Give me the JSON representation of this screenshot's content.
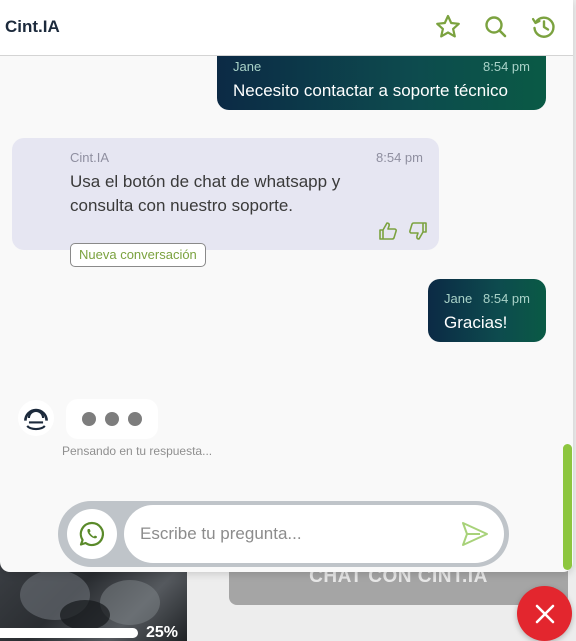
{
  "header": {
    "title": "Cint.IA",
    "icons": [
      "star-icon",
      "search-icon",
      "history-icon"
    ],
    "accent": "#7ba23f"
  },
  "messages": [
    {
      "sender": "Jane",
      "time": "8:54 pm",
      "text": "Necesito contactar a soporte técnico"
    },
    {
      "sender": "Cint.IA",
      "time": "8:54 pm",
      "text_line1": "Usa el botón de chat de whatsapp y",
      "text_line2": "consulta con nuestro soporte."
    },
    {
      "sender": "Jane",
      "time": "8:54 pm",
      "text": "Gracias!"
    }
  ],
  "new_conversation_label": "Nueva conversación",
  "thinking_label": "Pensando en tu respuesta...",
  "input": {
    "placeholder": "Escribe tu pregunta..."
  },
  "background": {
    "cta_label": "CHAT CON CINT.IA",
    "progress_label": "25%",
    "progress": 0.25
  },
  "colors": {
    "user_bubble": "#0d4b4e",
    "bot_bubble": "#e6e6f2",
    "accent_green": "#8dc63f",
    "close_red": "#e3262e",
    "brand_dark": "#1c2a3c"
  }
}
